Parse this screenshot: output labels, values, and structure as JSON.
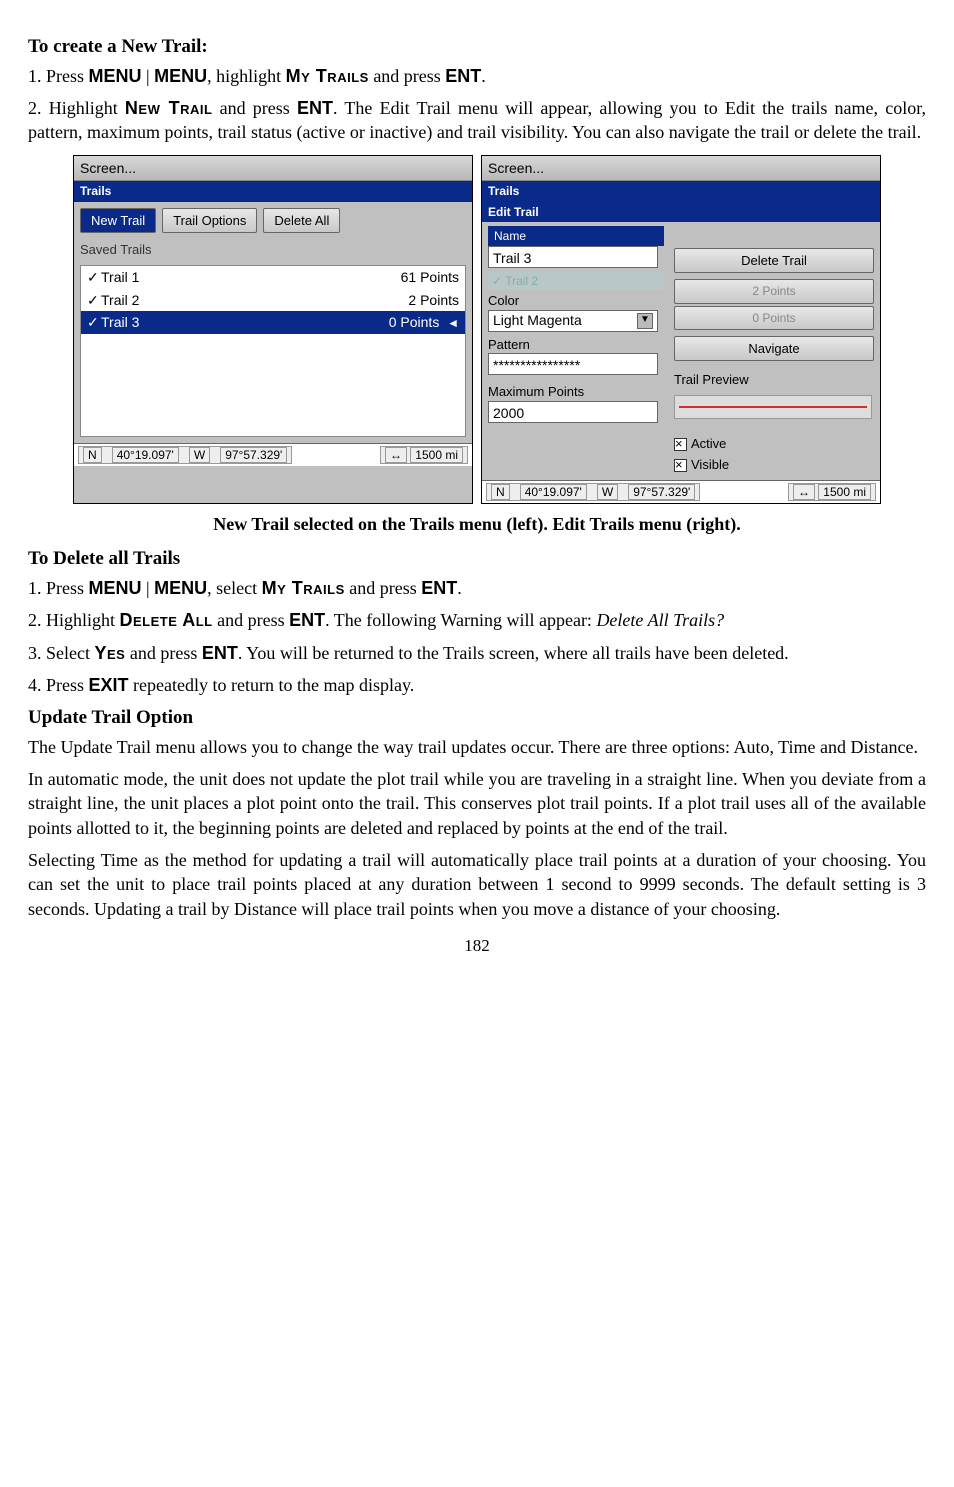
{
  "headings": {
    "h1": "To create a New Trail:",
    "h2": "To Delete all Trails",
    "h3": "Update Trail Option"
  },
  "steps_create": {
    "s1_a": "1. Press ",
    "s1_menu": "MENU",
    "s1_pipe": "|",
    "s1_b": ", highlight ",
    "s1_mytrails": "My Trails",
    "s1_c": " and press ",
    "s1_ent": "ENT",
    "s1_d": ".",
    "s2_a": "2. Highlight ",
    "s2_newtrail": "New Trail",
    "s2_b": " and press ",
    "s2_c": ". The Edit Trail menu will appear, allowing you to Edit the trails name, color, pattern, maximum points, trail status (active or inactive) and trail visibility. You can also navigate the trail or delete the trail."
  },
  "caption": "New Trail selected on the Trails menu (left). Edit Trails menu (right).",
  "steps_delete": {
    "s1_a": "1. Press ",
    "s1_b": ", select ",
    "s1_c": " and press ",
    "s1_d": ".",
    "s2_a": "2. Highlight ",
    "s2_del": "Delete All",
    "s2_b": " and press ",
    "s2_c": ". The following Warning will appear: ",
    "s2_it": "Delete All Trails?",
    "s3_a": "3. Select ",
    "s3_yes": "Yes",
    "s3_b": " and press ",
    "s3_c": ". You will be returned to the Trails screen, where all trails have been deleted.",
    "s4_a": "4. Press ",
    "s4_exit": "EXIT",
    "s4_b": " repeatedly to return to the map display."
  },
  "update_para1": "The Update Trail menu allows you to change the way trail updates occur. There are three options: Auto, Time and Distance.",
  "update_para2": "In automatic mode, the unit does not update the plot trail while you are traveling in a straight line. When you deviate from a straight line, the unit places a plot point onto the trail. This conserves plot trail points. If a plot trail uses all of the available points allotted to it, the beginning points are deleted and replaced by points at the end of the trail.",
  "update_para3": "Selecting Time as the method for updating a trail will automatically place trail points at a duration of your choosing. You can set the unit to place trail points placed at any duration between 1 second to 9999 seconds. The default setting is 3 seconds. Updating a trail by Distance will place trail points when you move a distance of your choosing.",
  "page_num": "182",
  "left_screen": {
    "title": "Screen...",
    "hdr": "Trails",
    "btn_new": "New Trail",
    "btn_opts": "Trail Options",
    "btn_del": "Delete All",
    "saved": "Saved Trails",
    "rows": [
      {
        "chk": "✓",
        "name": "Trail 1",
        "pts": "61 Points",
        "sel": false
      },
      {
        "chk": "✓",
        "name": "Trail 2",
        "pts": "2 Points",
        "sel": false
      },
      {
        "chk": "✓",
        "name": "Trail 3",
        "pts": "0 Points",
        "sel": true,
        "snd": "◄"
      }
    ],
    "status": {
      "n": "N",
      "lat": "40°19.097'",
      "w": "W",
      "lon": "97°57.329'",
      "arrow": "↔",
      "dist": "1500 mi"
    }
  },
  "right_screen": {
    "title": "Screen...",
    "hdr": "Trails",
    "edit_hdr": "Edit Trail",
    "name_hdr": "Name",
    "name_val": "Trail 3",
    "dim_row": {
      "chk": "✓",
      "name": "Trail 2",
      "pts": "2 Points"
    },
    "color_lbl": "Color",
    "color_val": "Light Magenta",
    "pattern_lbl": "Pattern",
    "pattern_val": "****************",
    "max_lbl": "Maximum Points",
    "max_val": "2000",
    "btn_delete": "Delete Trail",
    "dim_pts": "0 Points",
    "btn_nav": "Navigate",
    "preview_lbl": "Trail Preview",
    "chk_active": "Active",
    "chk_visible": "Visible",
    "status": {
      "n": "N",
      "lat": "40°19.097'",
      "w": "W",
      "lon": "97°57.329'",
      "arrow": "↔",
      "dist": "1500 mi"
    }
  }
}
